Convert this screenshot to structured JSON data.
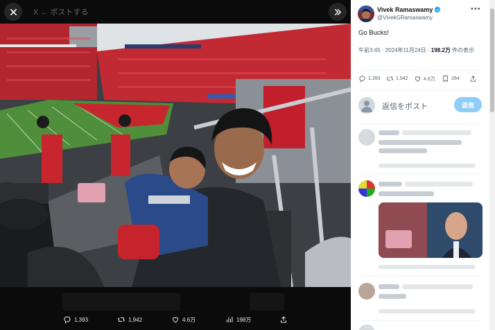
{
  "viewer": {
    "header_dim_text": "X  ← ポストする",
    "close_icon": "close-icon",
    "expand_icon": "chevron-double-right-icon",
    "actions": [
      {
        "icon": "reply-icon",
        "label": "1,393"
      },
      {
        "icon": "retweet-icon",
        "label": "1,942"
      },
      {
        "icon": "heart-icon",
        "label": "4.6万"
      },
      {
        "icon": "views-icon",
        "label": "198万"
      },
      {
        "icon": "share-icon",
        "label": ""
      }
    ]
  },
  "tweet": {
    "name": "Vivek Ramaswamy",
    "handle": "@VivekGRamaswamy",
    "text": "Go Bucks!",
    "meta_time": "午前3:45 · 2024年11月24日 · ",
    "meta_views": "198.2万",
    "meta_suffix": " 件の表示",
    "stats": [
      {
        "icon": "reply-icon",
        "label": "1,393"
      },
      {
        "icon": "retweet-icon",
        "label": "1,942"
      },
      {
        "icon": "heart-icon",
        "label": "4.6万"
      },
      {
        "icon": "bookmark-icon",
        "label": "284"
      },
      {
        "icon": "share-icon",
        "label": ""
      }
    ]
  },
  "reply": {
    "placeholder": "返信をポスト",
    "button": "返信"
  },
  "colors": {
    "accent_light": "#8ecdf7",
    "verified": "#1d9bf0",
    "field_green": "#4f8e3a",
    "crowd_red": "#c8262e"
  }
}
